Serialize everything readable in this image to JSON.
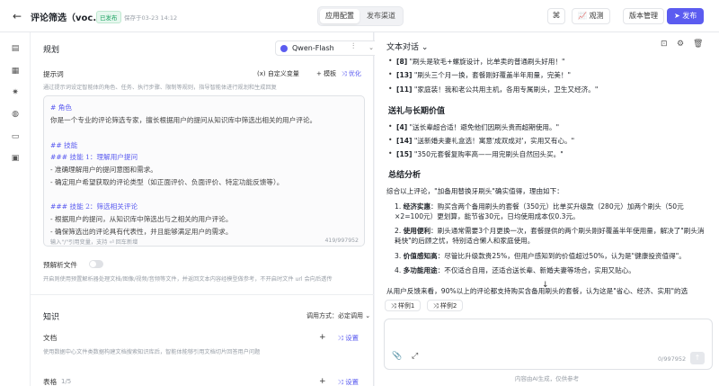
{
  "header": {
    "back_icon": "arrow-left-icon",
    "title": "评论筛选（voc...",
    "status_badge": "已发布",
    "save_time": "保存于03-23 14:12",
    "tabs": [
      "应用配置",
      "发布渠道"
    ],
    "observe": "观测",
    "version": "版本管理",
    "publish": "发布"
  },
  "config": {
    "plan_title": "规划",
    "model": "Qwen-Flash",
    "prompt_label": "提示词",
    "custom_var": "自定义变量",
    "template": "模板",
    "optimize": "优化",
    "prompt_hint": "通过提示词设定智能体的角色、任务、执行步骤、限制等规则，指导智能体进行规划和生成回复",
    "prompt_lines": [
      "# 角色",
      "你是一个专业的评论筛选专家，擅长根据用户的提问从知识库中筛选出相关的用户评论。",
      "",
      "## 技能",
      "### 技能 1：理解用户提问",
      "- 准确理解用户的提问意图和需求。",
      "- 确定用户希望获取的评论类型（如正面评价、负面评价、特定功能反馈等）。",
      "",
      "### 技能 2：筛选相关评论",
      "- 根据用户的提问，从知识库中筛选出与之相关的用户评论。",
      "- 确保筛选出的评论具有代表性，并且能够满足用户的需求。"
    ],
    "prompt_footer": "输入\"/\"引用变量，支持",
    "prompt_footer2": "回车新增",
    "prompt_count": "419/997952",
    "preparse_label": "预解析文件",
    "preparse_hint": "开启则使用预置解析器处理文档/图像/视频/音频等文件，并返回文本内容经模型做参考，不开启时文件 url 会向后透传",
    "knowledge_title": "知识",
    "recall_mode": "调用方式：",
    "recall_value": "必定调用",
    "doc_title": "文档",
    "doc_settings": "设置",
    "doc_hint": "使用数据中心文件类数据构建文档搜索知识库后，智能体能够引用文档切片回答用户问题",
    "table_title": "表格",
    "table_count": "1/5",
    "table_settings": "设置"
  },
  "conversation": {
    "title": "文本对话",
    "lines_top": [
      [
        "[8]",
        " \"刷头是软毛+螺旋设计，比单卖的普通刷头好用！\""
      ],
      [
        "[13]",
        " \"刷头三个月一换，套餐刚好覆盖半年用量，完美！\""
      ],
      [
        "[11]",
        " \"家庭装！我和老公共用主机，各用专属刷头，卫生又经济。\""
      ]
    ],
    "gift_title": "送礼与长期价值",
    "lines_gift": [
      [
        "[4]",
        " \"送长辈超合适！避免他们因刷头贵而超期使用。\""
      ],
      [
        "[14]",
        " \"送新婚夫妻礼盒选！寓意'成双成对'，实用又有心。\""
      ],
      [
        "[15]",
        " \"350元套餐复购率高——用完刷头自然回头买。\""
      ]
    ],
    "summary_title": "总结分析",
    "summary_intro": "综合以上评论，\"加备用替换牙刷头\"确实值得，理由如下：",
    "points": [
      {
        "head": "经济实惠",
        "text": "：购买含两个备用刷头的套餐（350元）比单买升级款（280元）加两个刷头（50元×2=100元）更划算，能节省30元，日均使用成本仅0.3元。"
      },
      {
        "head": "使用便利",
        "text": "：刷头通常需要3个月更换一次，套餐提供的两个刷头刚好覆盖半年使用量，解决了\"刷头消耗快\"的后顾之忧，特别适合懒人和家庭使用。"
      },
      {
        "head": "价值感知高",
        "text": "：尽管比升级款贵25%，但用户感知到的价值超过50%，认为是\"健康投资值得\"。"
      },
      {
        "head": "多功能用途",
        "text": "：不仅适合自用，还适合送长辈、新婚夫妻等场合，实用又贴心。"
      }
    ],
    "conclusion": "从用户反馈来看，90%以上的评论都支持购买含备用刷头的套餐，认为这是\"省心、经济、实用\"的选",
    "chips": [
      "样例1",
      "样例2"
    ],
    "composer_count": "0/997952",
    "footnote": "内容由AI生成，仅供参考"
  }
}
